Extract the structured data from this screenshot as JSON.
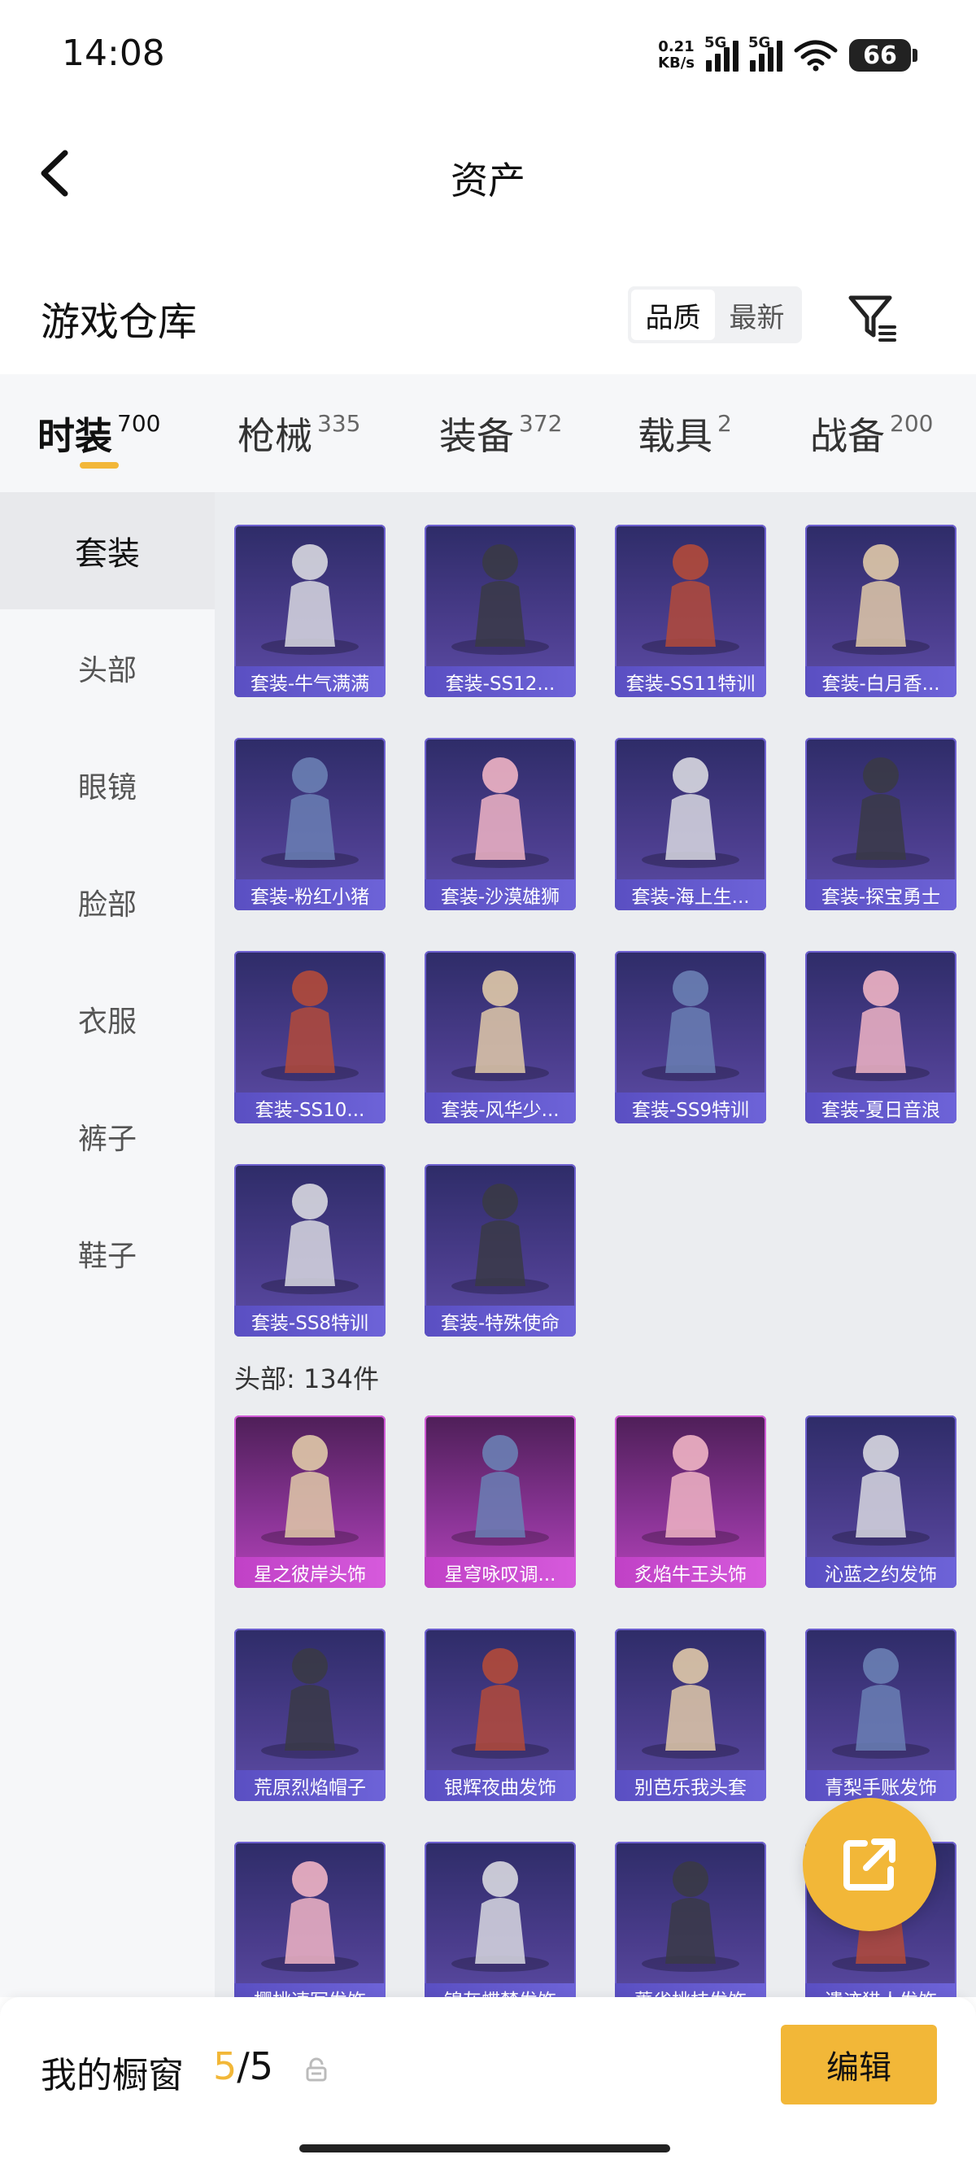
{
  "status_bar": {
    "time": "14:08",
    "net_speed_value": "0.21",
    "net_speed_unit": "KB/s",
    "signal1": "5G",
    "signal2": "5G",
    "battery": "66"
  },
  "header": {
    "title": "资产",
    "back_icon": "chevron-left-icon"
  },
  "warehouse": {
    "title": "游戏仓库",
    "sort_options": [
      "品质",
      "最新"
    ],
    "sort_selected": "品质",
    "filter_icon": "filter-icon"
  },
  "category_tabs": [
    {
      "name": "时装",
      "count": "700",
      "active": true
    },
    {
      "name": "枪械",
      "count": "335",
      "active": false
    },
    {
      "name": "装备",
      "count": "372",
      "active": false
    },
    {
      "name": "载具",
      "count": "2",
      "active": false
    },
    {
      "name": "战备",
      "count": "200",
      "active": false
    }
  ],
  "sidebar": [
    {
      "label": "套装",
      "active": true
    },
    {
      "label": "头部",
      "active": false
    },
    {
      "label": "眼镜",
      "active": false
    },
    {
      "label": "脸部",
      "active": false
    },
    {
      "label": "衣服",
      "active": false
    },
    {
      "label": "裤子",
      "active": false
    },
    {
      "label": "鞋子",
      "active": false
    }
  ],
  "outfits": [
    {
      "label": "套装-牛气满满"
    },
    {
      "label": "套装-SS12..."
    },
    {
      "label": "套装-SS11特训"
    },
    {
      "label": "套装-白月香..."
    },
    {
      "label": "套装-粉红小猪"
    },
    {
      "label": "套装-沙漠雄狮"
    },
    {
      "label": "套装-海上生..."
    },
    {
      "label": "套装-探宝勇士"
    },
    {
      "label": "套装-SS10..."
    },
    {
      "label": "套装-风华少..."
    },
    {
      "label": "套装-SS9特训"
    },
    {
      "label": "套装-夏日音浪"
    },
    {
      "label": "套装-SS8特训"
    },
    {
      "label": "套装-特殊使命"
    }
  ],
  "head_section": {
    "header": "头部: 134件",
    "items": [
      {
        "label": "星之彼岸头饰",
        "tier": "pink"
      },
      {
        "label": "星穹咏叹调...",
        "tier": "pink"
      },
      {
        "label": "炙焰牛王头饰",
        "tier": "pink"
      },
      {
        "label": "沁蓝之约发饰",
        "tier": "purple"
      },
      {
        "label": "荒原烈焰帽子",
        "tier": "purple"
      },
      {
        "label": "银辉夜曲发饰",
        "tier": "purple"
      },
      {
        "label": "别芭乐我头套",
        "tier": "purple"
      },
      {
        "label": "青梨手账发饰",
        "tier": "purple"
      },
      {
        "label": "樱桃速写发饰",
        "tier": "purple"
      },
      {
        "label": "锦灰蝶梦发饰",
        "tier": "purple"
      },
      {
        "label": "蔷雀桃枝发饰",
        "tier": "purple"
      },
      {
        "label": "遗迹猎人发饰",
        "tier": "purple"
      }
    ]
  },
  "fab": {
    "icon": "share-external-icon"
  },
  "bottom_bar": {
    "label": "我的橱窗",
    "current": "5",
    "total": "/5",
    "lock_icon": "lock-icon",
    "edit_label": "编辑"
  }
}
